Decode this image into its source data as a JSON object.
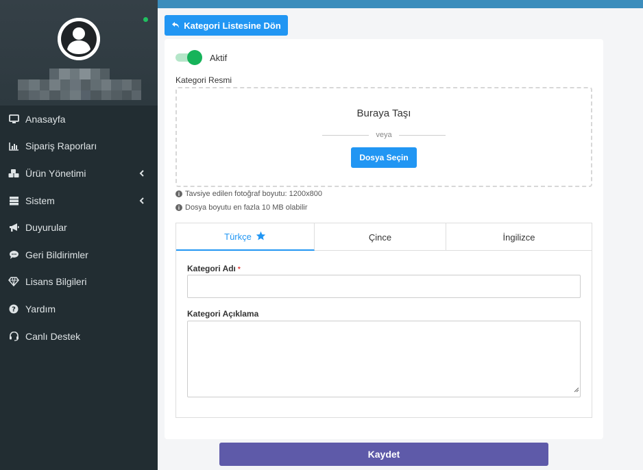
{
  "sidebar": {
    "items": [
      {
        "label": "Anasayfa",
        "icon": "monitor-icon",
        "has_submenu": false
      },
      {
        "label": "Sipariş Raporları",
        "icon": "bar-chart-icon",
        "has_submenu": false
      },
      {
        "label": "Ürün Yönetimi",
        "icon": "cubes-icon",
        "has_submenu": true
      },
      {
        "label": "Sistem",
        "icon": "server-icon",
        "has_submenu": true
      },
      {
        "label": "Duyurular",
        "icon": "bullhorn-icon",
        "has_submenu": false
      },
      {
        "label": "Geri Bildirimler",
        "icon": "comment-icon",
        "has_submenu": false
      },
      {
        "label": "Lisans Bilgileri",
        "icon": "diamond-icon",
        "has_submenu": false
      },
      {
        "label": "Yardım",
        "icon": "question-icon",
        "has_submenu": false
      },
      {
        "label": "Canlı Destek",
        "icon": "headset-icon",
        "has_submenu": false
      }
    ]
  },
  "header": {
    "back_button": "Kategori Listesine Dön"
  },
  "form": {
    "status_label": "Aktif",
    "status_on": true,
    "image_label": "Kategori Resmi",
    "dropzone": {
      "title": "Buraya Taşı",
      "or": "veya",
      "button": "Dosya Seçin"
    },
    "hints": [
      "Tavsiye edilen fotoğraf boyutu: 1200x800",
      "Dosya boyutu en fazla 10 MB olabilir"
    ],
    "tabs": [
      {
        "label": "Türkçe",
        "active": true
      },
      {
        "label": "Çince",
        "active": false
      },
      {
        "label": "İngilizce",
        "active": false
      }
    ],
    "name_label": "Kategori Adı",
    "name_required": "*",
    "name_value": "",
    "desc_label": "Kategori Açıklama",
    "desc_value": ""
  },
  "footer": {
    "save_button": "Kaydet"
  },
  "colors": {
    "sidebar_bg": "#222d32",
    "topbar": "#3c8dbc",
    "primary": "#2196f3",
    "save": "#5e5aa9",
    "toggle_on": "#16b35a",
    "online": "#20c060"
  }
}
